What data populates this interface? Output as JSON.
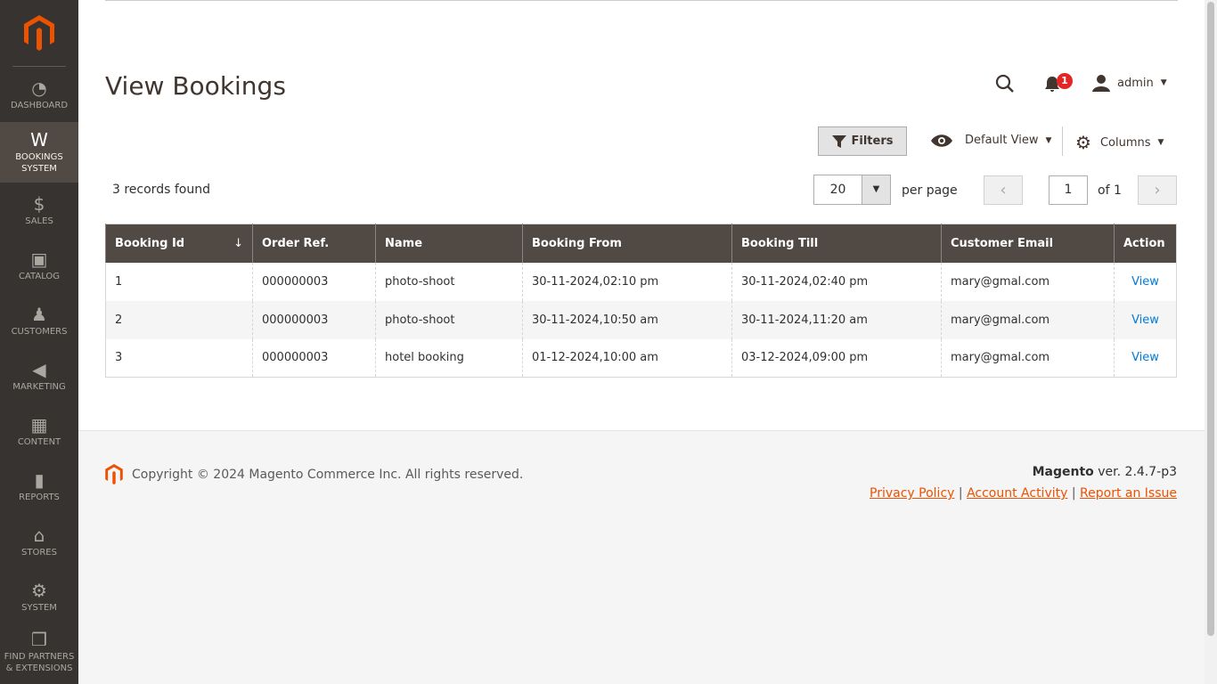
{
  "sidebar": {
    "items": [
      {
        "label": "DASHBOARD",
        "icon": "dashboard-icon",
        "glyph": "◔"
      },
      {
        "label": "BOOKINGS SYSTEM",
        "icon": "bookings-icon",
        "glyph": "W",
        "active": true
      },
      {
        "label": "SALES",
        "icon": "dollar-icon",
        "glyph": "$"
      },
      {
        "label": "CATALOG",
        "icon": "box-icon",
        "glyph": "▣"
      },
      {
        "label": "CUSTOMERS",
        "icon": "person-icon",
        "glyph": "♟"
      },
      {
        "label": "MARKETING",
        "icon": "megaphone-icon",
        "glyph": "◀"
      },
      {
        "label": "CONTENT",
        "icon": "layout-icon",
        "glyph": "▦"
      },
      {
        "label": "REPORTS",
        "icon": "bar-chart-icon",
        "glyph": "▮"
      },
      {
        "label": "STORES",
        "icon": "store-icon",
        "glyph": "⌂"
      },
      {
        "label": "SYSTEM",
        "icon": "gear-icon",
        "glyph": "⚙"
      },
      {
        "label": "FIND PARTNERS & EXTENSIONS",
        "icon": "blocks-icon",
        "glyph": "❒"
      }
    ]
  },
  "header": {
    "title": "View Bookings",
    "notifications": "1",
    "user": "admin"
  },
  "toolbar": {
    "filters": "Filters",
    "view": "Default View",
    "columns": "Columns"
  },
  "grid": {
    "records": "3 records found",
    "per_page_value": "20",
    "per_page_label": "per page",
    "page": "1",
    "of": "of 1",
    "columns": [
      "Booking Id",
      "Order Ref.",
      "Name",
      "Booking From",
      "Booking Till",
      "Customer Email",
      "Action"
    ],
    "sort_indicator": "↓",
    "rows": [
      [
        "1",
        "000000003",
        "photo-shoot",
        "30-11-2024,02:10 pm",
        "30-11-2024,02:40 pm",
        "mary@gmal.com",
        "View"
      ],
      [
        "2",
        "000000003",
        "photo-shoot",
        "30-11-2024,10:50 am",
        "30-11-2024,11:20 am",
        "mary@gmal.com",
        "View"
      ],
      [
        "3",
        "000000003",
        "hotel booking",
        "01-12-2024,10:00 am",
        "03-12-2024,09:00 pm",
        "mary@gmal.com",
        "View"
      ]
    ]
  },
  "footer": {
    "copyright": "Copyright © 2024 Magento Commerce Inc. All rights reserved.",
    "brand": "Magento",
    "version": " ver. 2.4.7-p3",
    "links": [
      "Privacy Policy",
      "Account Activity",
      "Report an Issue"
    ]
  },
  "colors": {
    "accent": "#eb5202",
    "sidebar": "#373330",
    "header_row": "#514943",
    "link": "#007bdb"
  }
}
